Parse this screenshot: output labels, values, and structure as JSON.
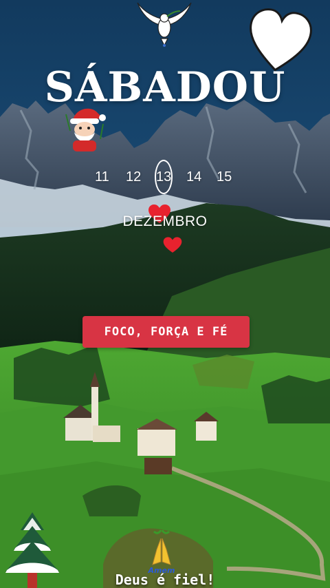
{
  "header": {
    "title": "SÁBADOU"
  },
  "calendar": {
    "days": [
      "11",
      "12",
      "13",
      "14",
      "15"
    ],
    "selected_day": "13",
    "month": "DEZEMBRO"
  },
  "motto": {
    "label": "FOCO, FORÇA E FÉ"
  },
  "footer": {
    "text": "Deus é fiel!",
    "praying_badge": "Amem"
  },
  "colors": {
    "accent_red": "#d83444",
    "heart_red": "#e8222e",
    "sky": "#1a4c78",
    "grass": "#3e8f2c"
  },
  "icons": [
    "dove-icon",
    "heart-outline-icon",
    "santa-icon",
    "heart-icon",
    "christmas-tree-icon",
    "praying-hands-icon"
  ]
}
